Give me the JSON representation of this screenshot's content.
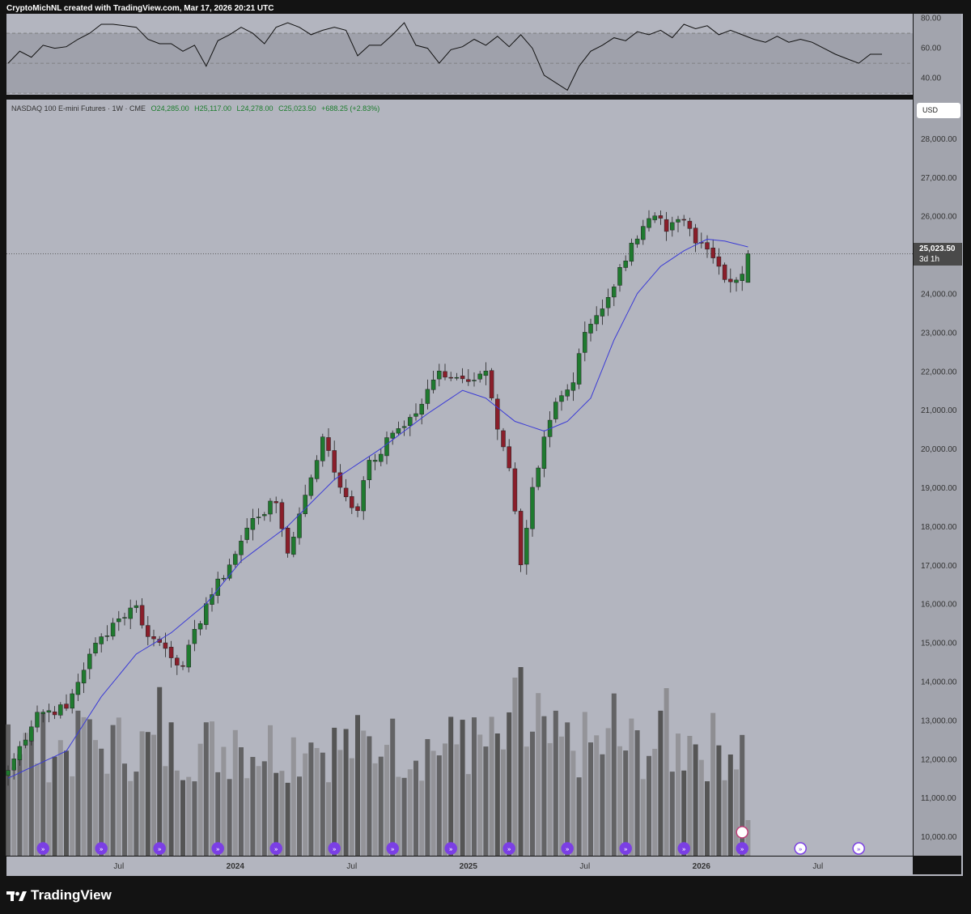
{
  "header_text": "CryptoMichNL created with TradingView.com, Mar 17, 2026 20:21 UTC",
  "brand": "TradingView",
  "legend": {
    "symbol": "NASDAQ 100 E-mini Futures · 1W · CME",
    "open": "O24,285.00",
    "high": "H25,117.00",
    "low": "L24,278.00",
    "close": "C25,023.50",
    "change": "+688.25 (+2.83%)"
  },
  "currency": "USD",
  "last_price": {
    "value": "25,023.50",
    "countdown": "3d 1h"
  },
  "colors": {
    "background": "#131313",
    "panel": "#b3b5bf",
    "rsi_band": "#9fa1ab",
    "up": "#1f7a2f",
    "down": "#8a1e2a",
    "ma": "#3b3bd6",
    "volume_dark": "#555555",
    "volume_light": "#8e8e92",
    "event_icon": "#7b3fe4"
  },
  "chart_data": [
    {
      "type": "line",
      "name": "rsi",
      "title": "",
      "ylim": [
        29,
        83
      ],
      "yticks": [
        80,
        60,
        40
      ],
      "ytick_labels": [
        "80.00",
        "60.00",
        "40.00"
      ],
      "band": [
        30,
        70
      ],
      "midline": 50,
      "x": [
        0,
        2,
        4,
        6,
        8,
        10,
        12,
        14,
        16,
        18,
        20,
        22,
        24,
        26,
        28,
        30,
        32,
        34,
        36,
        38,
        40,
        42,
        44,
        46,
        48,
        50,
        52,
        54,
        56,
        58,
        60,
        62,
        64,
        66,
        68,
        70,
        72,
        74,
        76,
        78,
        80,
        82,
        84,
        86,
        88,
        90,
        92,
        94,
        96,
        98,
        100,
        102,
        104,
        106,
        108,
        110,
        112,
        114,
        116,
        118,
        120,
        122,
        124,
        126,
        128,
        130,
        132,
        134,
        136,
        138,
        140,
        142,
        144,
        146,
        148,
        150
      ],
      "values": [
        50,
        58,
        54,
        62,
        60,
        61,
        66,
        70,
        76,
        76,
        75,
        74,
        66,
        63,
        63,
        58,
        62,
        48,
        65,
        69,
        74,
        70,
        63,
        74,
        77,
        74,
        69,
        72,
        74,
        72,
        55,
        62,
        62,
        69,
        77,
        62,
        60,
        50,
        59,
        61,
        66,
        62,
        68,
        61,
        69,
        60,
        42,
        37,
        32,
        48,
        58,
        62,
        67,
        65,
        71,
        69,
        72,
        67,
        76,
        73,
        75,
        69,
        72,
        69,
        66,
        64,
        68,
        64,
        66,
        64,
        60,
        56,
        53,
        50,
        56,
        56
      ],
      "x_note": "weeks since the first bar shown"
    },
    {
      "type": "candlestick",
      "name": "NASDAQ 100 E-mini Futures · 1W · CME",
      "title": "",
      "ylim": [
        9500,
        29000
      ],
      "yticks": [
        10000,
        11000,
        12000,
        13000,
        14000,
        15000,
        16000,
        17000,
        18000,
        19000,
        20000,
        21000,
        22000,
        23000,
        24000,
        25000,
        26000,
        27000,
        28000
      ],
      "ytick_labels": [
        "10,000.00",
        "11,000.00",
        "12,000.00",
        "13,000.00",
        "14,000.00",
        "15,000.00",
        "16,000.00",
        "17,000.00",
        "18,000.00",
        "19,000.00",
        "20,000.00",
        "21,000.00",
        "22,000.00",
        "23,000.00",
        "24,000.00",
        "25,000.00",
        "26,000.00",
        "27,000.00",
        "28,000.00"
      ],
      "xtick_labels": [
        {
          "label": "Jul",
          "week": 19
        },
        {
          "label": "2024",
          "week": 39
        },
        {
          "label": "Jul",
          "week": 59
        },
        {
          "label": "2025",
          "week": 79
        },
        {
          "label": "Jul",
          "week": 99
        },
        {
          "label": "2026",
          "week": 119
        },
        {
          "label": "Jul",
          "week": 139
        }
      ],
      "last_price": 25023.5,
      "close_anchors": {
        "week": [
          0,
          5,
          10,
          14,
          18,
          22,
          24,
          26,
          30,
          34,
          38,
          42,
          46,
          48,
          51,
          54,
          57,
          60,
          62,
          63,
          66,
          70,
          74,
          78,
          82,
          84,
          86,
          88,
          90,
          91,
          92,
          94,
          97,
          99,
          103,
          107,
          111,
          113,
          116,
          118,
          119,
          122,
          124,
          126,
          127
        ],
        "close": [
          11700,
          13200,
          13300,
          14700,
          15500,
          15950,
          15150,
          15000,
          14400,
          16000,
          17000,
          18200,
          18600,
          17300,
          18800,
          20300,
          19000,
          18400,
          19700,
          19700,
          20400,
          20900,
          22000,
          21800,
          22000,
          20500,
          19500,
          17000,
          19000,
          19500,
          20300,
          21200,
          21700,
          23000,
          23900,
          25300,
          26000,
          25600,
          25900,
          25300,
          25300,
          24700,
          24300,
          24500,
          25023.5
        ]
      },
      "ma_anchors": {
        "week": [
          0,
          10,
          16,
          22,
          28,
          34,
          40,
          48,
          56,
          64,
          72,
          78,
          82,
          87,
          92,
          96,
          100,
          104,
          108,
          112,
          116,
          120,
          123,
          127
        ],
        "ma": [
          11500,
          12200,
          13600,
          14700,
          15250,
          16000,
          17100,
          18000,
          19200,
          20000,
          20900,
          21500,
          21300,
          20700,
          20450,
          20700,
          21300,
          22800,
          24000,
          24700,
          25100,
          25400,
          25350,
          25200
        ]
      },
      "count": 128,
      "x_note": "weeks since the first bar shown"
    }
  ]
}
